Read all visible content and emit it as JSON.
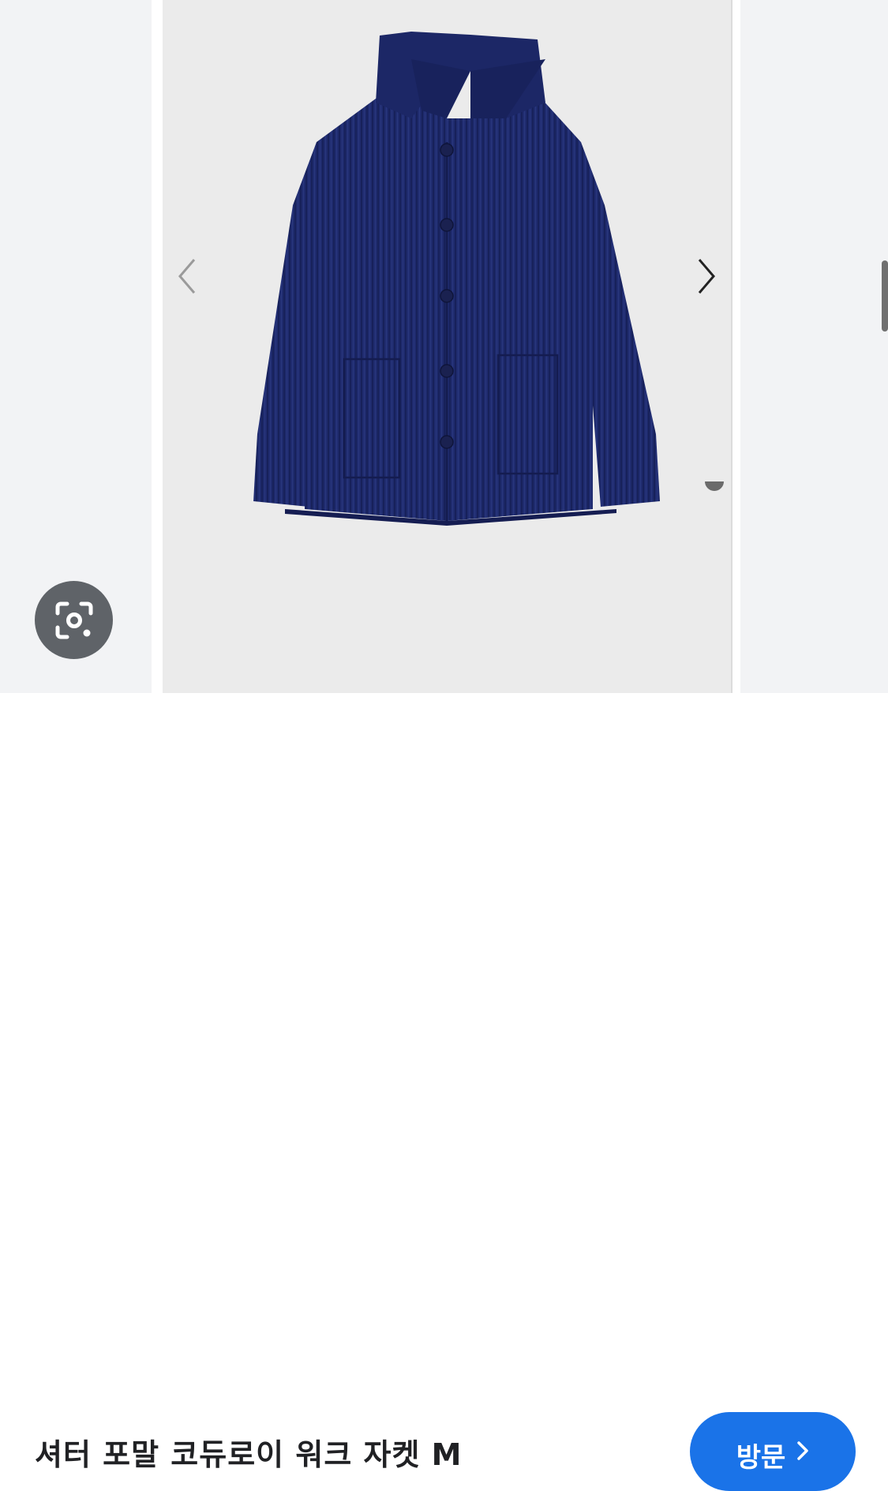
{
  "viewer": {
    "image_alt": "navy corduroy work jacket",
    "prev_icon": "chevron-left-icon",
    "next_icon": "chevron-right-icon",
    "lens_icon": "google-lens-icon"
  },
  "product": {
    "title": "셔터 포말 코듀로이 워크 자켓 M"
  },
  "actions": {
    "visit_label": "방문",
    "visit_icon": "chevron-right-icon",
    "accent_color": "#1a73e8"
  }
}
